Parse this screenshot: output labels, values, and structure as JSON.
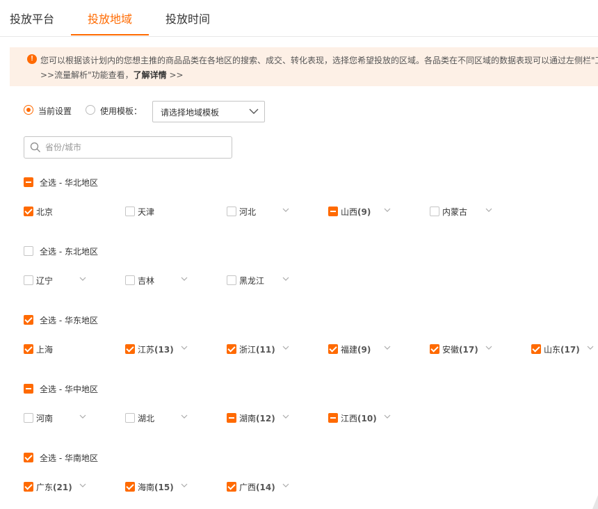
{
  "tabs": [
    {
      "label": "投放平台",
      "active": false
    },
    {
      "label": "投放地域",
      "active": true
    },
    {
      "label": "投放时间",
      "active": false
    }
  ],
  "notice": {
    "icon": "info-icon",
    "line1": "您可以根据该计划内的您想主推的商品品类在各地区的搜索、成交、转化表现，选择您希望投放的区域。各品类在不同区域的数据表现可以通过左侧栏\"工",
    "line2_prefix": ">>流量解析\"功能查看，",
    "line2_link": "了解详情",
    "line2_suffix": " >>"
  },
  "settings": {
    "current_label": "当前设置",
    "template_label": "使用模板：",
    "template_placeholder": "请选择地域模板"
  },
  "search": {
    "placeholder": "省份/城市"
  },
  "groups": [
    {
      "label": "全选 - 华北地区",
      "state": "partial",
      "provinces": [
        {
          "name": "北京",
          "count": "",
          "state": "checked",
          "expandable": false
        },
        {
          "name": "天津",
          "count": "",
          "state": "unchecked",
          "expandable": false
        },
        {
          "name": "河北",
          "count": "",
          "state": "unchecked",
          "expandable": true
        },
        {
          "name": "山西",
          "count": "(9)",
          "state": "partial",
          "expandable": true
        },
        {
          "name": "内蒙古",
          "count": "",
          "state": "unchecked",
          "expandable": true
        }
      ]
    },
    {
      "label": "全选 - 东北地区",
      "state": "unchecked",
      "provinces": [
        {
          "name": "辽宁",
          "count": "",
          "state": "unchecked",
          "expandable": true
        },
        {
          "name": "吉林",
          "count": "",
          "state": "unchecked",
          "expandable": true
        },
        {
          "name": "黑龙江",
          "count": "",
          "state": "unchecked",
          "expandable": true
        }
      ]
    },
    {
      "label": "全选 - 华东地区",
      "state": "checked",
      "provinces": [
        {
          "name": "上海",
          "count": "",
          "state": "checked",
          "expandable": false
        },
        {
          "name": "江苏",
          "count": "(13)",
          "state": "checked",
          "expandable": true
        },
        {
          "name": "浙江",
          "count": "(11)",
          "state": "checked",
          "expandable": true
        },
        {
          "name": "福建",
          "count": "(9)",
          "state": "checked",
          "expandable": true
        },
        {
          "name": "安徽",
          "count": "(17)",
          "state": "checked",
          "expandable": true
        },
        {
          "name": "山东",
          "count": "(17)",
          "state": "checked",
          "expandable": true
        }
      ]
    },
    {
      "label": "全选 - 华中地区",
      "state": "partial",
      "provinces": [
        {
          "name": "河南",
          "count": "",
          "state": "unchecked",
          "expandable": true
        },
        {
          "name": "湖北",
          "count": "",
          "state": "unchecked",
          "expandable": true
        },
        {
          "name": "湖南",
          "count": "(12)",
          "state": "partial",
          "expandable": true
        },
        {
          "name": "江西",
          "count": "(10)",
          "state": "partial",
          "expandable": true
        }
      ]
    },
    {
      "label": "全选 - 华南地区",
      "state": "checked",
      "provinces": [
        {
          "name": "广东",
          "count": "(21)",
          "state": "checked",
          "expandable": true
        },
        {
          "name": "海南",
          "count": "(15)",
          "state": "checked",
          "expandable": true
        },
        {
          "name": "广西",
          "count": "(14)",
          "state": "checked",
          "expandable": true
        }
      ]
    }
  ],
  "colors": {
    "accent": "#ff6a00",
    "notice_bg": "#fdf0e6"
  }
}
